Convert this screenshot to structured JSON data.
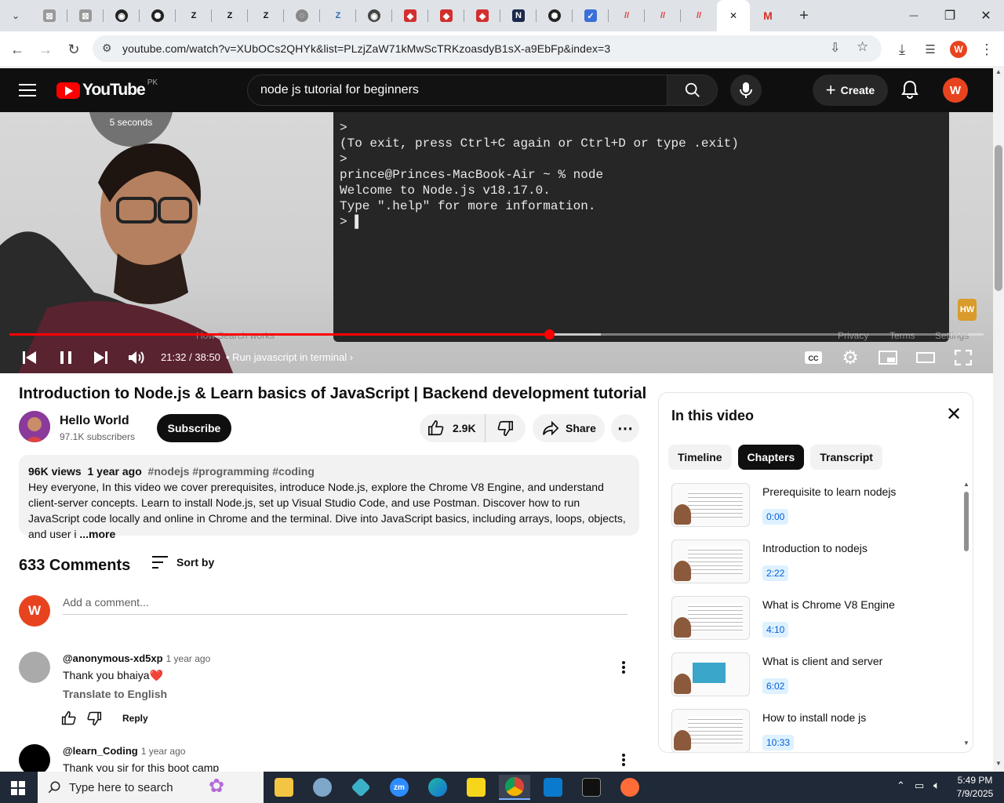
{
  "browser": {
    "active_tab_close": "✕",
    "new_tab": "+",
    "url": "youtube.com/watch?v=XUbOCs2QHYk&list=PLzjZaW71kMwScTRKzoasdyB1sX-a9EbFp&index=3",
    "profile_initial": "W",
    "window": {
      "minimize": "—",
      "restore": "❐",
      "close": "✕"
    }
  },
  "youtube": {
    "logo_text": "YouTube",
    "country_code": "PK",
    "search_query": "node js tutorial for beginners",
    "create_label": "Create",
    "user_initial": "W"
  },
  "player": {
    "skip_badge": "5 seconds",
    "terminal_lines": [
      ">",
      "(To exit, press Ctrl+C again or Ctrl+D or type .exit)",
      ">",
      "prince@Princes-MacBook-Air ~ % node",
      "Welcome to Node.js v18.17.0.",
      "Type \".help\" for more information.",
      "> ▌"
    ],
    "watermark": "HW",
    "ghost_text": [
      "Privacy",
      "Terms",
      "Settings",
      "How Search works"
    ],
    "time": "21:32 / 38:50",
    "chapter_title": "• Run javascript in terminal",
    "played_fraction": 0.554,
    "buffered_fraction": 0.607
  },
  "video": {
    "title": "Introduction to Node.js & Learn basics of JavaScript | Backend development tutorial",
    "channel_name": "Hello World",
    "subscribers": "97.1K subscribers",
    "subscribe_label": "Subscribe",
    "likes": "2.9K",
    "share_label": "Share"
  },
  "description": {
    "views": "96K views",
    "age": "1 year ago",
    "tags": "#nodejs #programming #coding",
    "text": "Hey everyone, In this video we cover prerequisites, introduce Node.js, explore the Chrome V8 Engine, and understand client-server concepts. Learn to install Node.js, set up Visual Studio Code, and use Postman. Discover how to run JavaScript code locally and online in Chrome and the terminal. Dive into JavaScript basics, including arrays, loops, objects, and user i",
    "more_label": "...more"
  },
  "comments": {
    "count_label": "633 Comments",
    "sort_label": "Sort by",
    "add_placeholder": "Add a comment...",
    "user_initial": "W",
    "items": [
      {
        "user": "@anonymous-xd5xp",
        "age": "1 year ago",
        "text": "Thank you bhaiya❤️",
        "translate": "Translate to English",
        "reply": "Reply"
      },
      {
        "user": "@learn_Coding",
        "age": "1 year ago",
        "text": "Thank you sir for this boot camp"
      }
    ]
  },
  "panel": {
    "title": "In this video",
    "tabs": [
      "Timeline",
      "Chapters",
      "Transcript"
    ],
    "chapters": [
      {
        "name": "Prerequisite to learn nodejs",
        "time": "0:00"
      },
      {
        "name": "Introduction to nodejs",
        "time": "2:22"
      },
      {
        "name": "What is Chrome V8 Engine",
        "time": "4:10"
      },
      {
        "name": "What is client and server",
        "time": "6:02"
      },
      {
        "name": "How to install node js",
        "time": "10:33"
      }
    ]
  },
  "taskbar": {
    "search_placeholder": "Type here to search",
    "time": "5:49 PM",
    "date": "7/9/2025"
  },
  "colors": {
    "youtube_red": "#ff0000",
    "link_blue": "#065fd4",
    "avatar_orange": "#e8431f"
  }
}
